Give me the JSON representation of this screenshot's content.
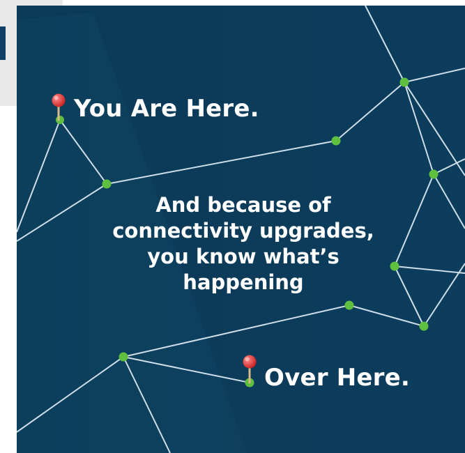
{
  "graphic": {
    "headline_top": "You Are Here.",
    "body_lines": [
      "And because of",
      "connectivity upgrades,",
      "you know what’s",
      "happening"
    ],
    "headline_bottom": "Over Here."
  },
  "colors": {
    "background": "#0c3b59",
    "accent": "#5fbf3f",
    "pin": "#e03b3b"
  },
  "icons": [
    "map-pin-icon",
    "map-pin-icon"
  ]
}
